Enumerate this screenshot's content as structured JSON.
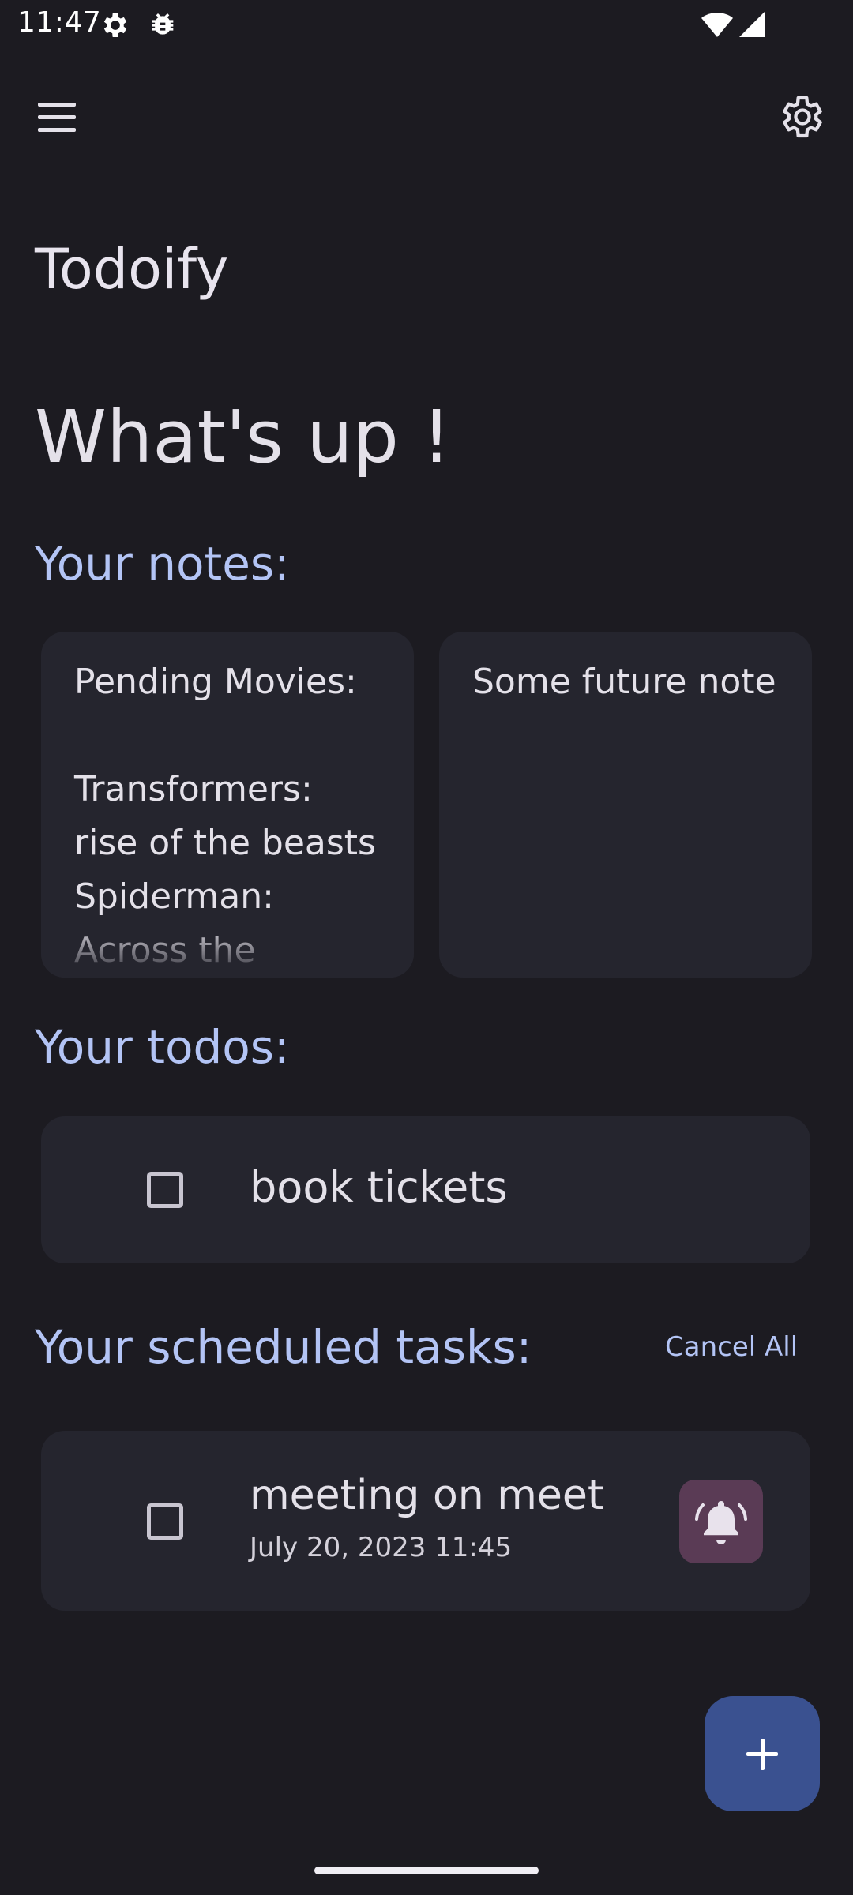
{
  "status_bar": {
    "time": "11:47",
    "icons": [
      "settings-gear-icon",
      "debug-bug-icon",
      "wifi-icon",
      "cellular-signal-icon"
    ]
  },
  "app_bar": {
    "menu_icon": "hamburger-menu-icon",
    "settings_icon": "gear-icon"
  },
  "app_title": "Todoify",
  "greeting": "What's up !",
  "notes_section": {
    "heading": "Your notes:",
    "notes": [
      {
        "text": "Pending Movies:\n\nTransformers: rise of the beasts\nSpiderman:\nAcross the"
      },
      {
        "text": "Some future note"
      }
    ]
  },
  "todos_section": {
    "heading": "Your todos:",
    "items": [
      {
        "label": "book tickets",
        "checked": false
      }
    ]
  },
  "scheduled_section": {
    "heading": "Your scheduled tasks:",
    "cancel_all_label": "Cancel All",
    "items": [
      {
        "title": "meeting on meet",
        "datetime": "July 20, 2023 11:45",
        "checked": false,
        "alarm_icon": "bell-ringing-icon"
      }
    ]
  },
  "fab": {
    "icon": "plus-icon"
  },
  "colors": {
    "background": "#1c1b21",
    "card": "#25252e",
    "accent_text": "#b3c4f5",
    "fab": "#3a5190",
    "alarm_button": "#5a3b55"
  }
}
